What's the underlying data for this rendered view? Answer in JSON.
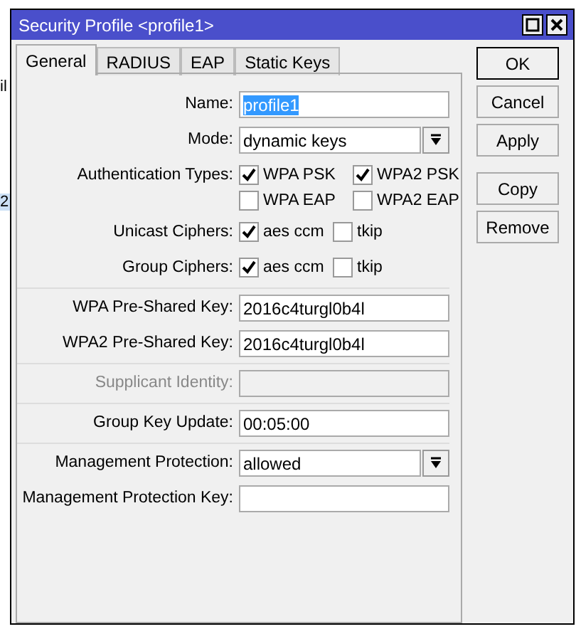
{
  "background": {
    "texts": [
      "il",
      "2"
    ]
  },
  "window": {
    "title": "Security Profile <profile1>"
  },
  "tabs": [
    {
      "label": "General",
      "selected": true
    },
    {
      "label": "RADIUS",
      "selected": false
    },
    {
      "label": "EAP",
      "selected": false
    },
    {
      "label": "Static Keys",
      "selected": false
    }
  ],
  "sections": [
    {
      "rows": [
        {
          "kind": "text",
          "label": "Name:",
          "value": "profile1",
          "highlighted": true,
          "disabled": false
        },
        {
          "kind": "select",
          "label": "Mode:",
          "value": "dynamic keys"
        },
        {
          "kind": "checks",
          "label": "Authentication Types:",
          "wide": true,
          "options": [
            {
              "label": "WPA PSK",
              "checked": true
            },
            {
              "label": "WPA2 PSK",
              "checked": true
            },
            {
              "label": "WPA EAP",
              "checked": false
            },
            {
              "label": "WPA2 EAP",
              "checked": false
            }
          ]
        },
        {
          "kind": "checks",
          "label": "Unicast Ciphers:",
          "wide": false,
          "options": [
            {
              "label": "aes ccm",
              "checked": true
            },
            {
              "label": "tkip",
              "checked": false
            }
          ]
        },
        {
          "kind": "checks",
          "label": "Group Ciphers:",
          "wide": false,
          "options": [
            {
              "label": "aes ccm",
              "checked": true
            },
            {
              "label": "tkip",
              "checked": false
            }
          ]
        }
      ]
    },
    {
      "rows": [
        {
          "kind": "text",
          "label": "WPA Pre-Shared Key:",
          "value": "2016c4turgl0b4l",
          "highlighted": false,
          "disabled": false
        },
        {
          "kind": "text",
          "label": "WPA2 Pre-Shared Key:",
          "value": "2016c4turgl0b4l",
          "highlighted": false,
          "disabled": false
        }
      ]
    },
    {
      "rows": [
        {
          "kind": "text",
          "label": "Supplicant Identity:",
          "disabled": true
        }
      ]
    },
    {
      "rows": [
        {
          "kind": "text",
          "label": "Group Key Update:",
          "value": "00:05:00",
          "highlighted": false,
          "disabled": false
        }
      ]
    },
    {
      "rows": [
        {
          "kind": "select",
          "label": "Management Protection:",
          "value": "allowed"
        },
        {
          "kind": "text",
          "label": "Management Protection Key:",
          "disabled": false
        }
      ]
    }
  ],
  "button_groups": [
    {
      "buttons": [
        {
          "label": "OK",
          "default": true
        },
        {
          "label": "Cancel",
          "default": false
        },
        {
          "label": "Apply",
          "default": false
        }
      ]
    },
    {
      "buttons": [
        {
          "label": "Copy",
          "default": false
        },
        {
          "label": "Remove",
          "default": false
        }
      ]
    }
  ]
}
